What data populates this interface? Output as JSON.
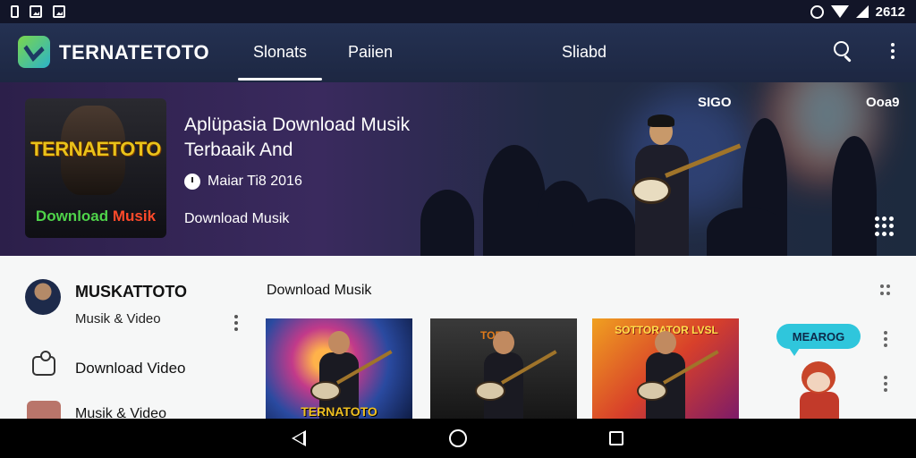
{
  "status_bar": {
    "time": "2612",
    "left_icons": [
      "phone-icon",
      "image-icon",
      "gallery-icon"
    ],
    "right_icons": [
      "circle-icon",
      "wifi-icon",
      "signal-icon"
    ]
  },
  "app_bar": {
    "brand": "TERNATETOTO",
    "tabs": [
      {
        "label": "Slonats",
        "active": true
      },
      {
        "label": "Paiien",
        "active": false
      },
      {
        "label": "Sliabd",
        "active": false
      }
    ],
    "accent": "#ffffff",
    "background": "#243152"
  },
  "hero": {
    "cover_title": "TERNAETOTO",
    "cover_sub_a": "Download",
    "cover_sub_b": "Musik",
    "title": "Aplüpasia Download Musik Terbaaik And",
    "meta": "Maiar Ti8 2016",
    "category": "Download Musik",
    "overlay_a": "SIGO",
    "overlay_b": "Ooa9"
  },
  "sidebar": {
    "title": "MUSKATTOTO",
    "subtitle": "Musik & Video",
    "items": [
      {
        "label": "Download Video",
        "icon": "download-video-icon"
      },
      {
        "label": "Musik & Video",
        "icon": "music-video-icon"
      }
    ]
  },
  "section": {
    "title": "Download Musik",
    "cards": [
      {
        "tag": "",
        "label": "TERNATOTO"
      },
      {
        "tag": "TORB",
        "label": ""
      },
      {
        "tag": "SOTTORATOR LVSL",
        "label": ""
      }
    ],
    "bubble": "MEAROG"
  },
  "nav_bar": {
    "icons": [
      "back-icon",
      "home-icon",
      "recents-icon"
    ]
  }
}
